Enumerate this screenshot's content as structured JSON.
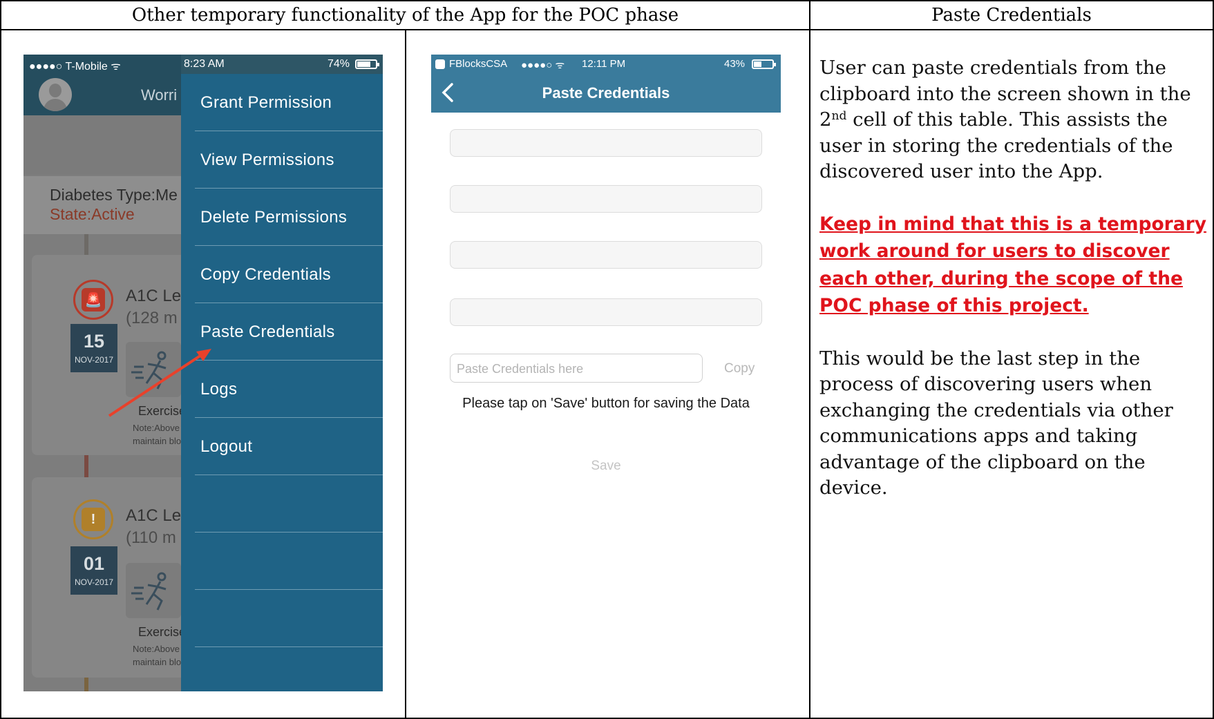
{
  "table": {
    "header_left": "Other temporary functionality of the App for the POC phase",
    "header_right": "Paste Credentials"
  },
  "phone_menu": {
    "status": {
      "carrier": "●●●●○ T-Mobile ᯤ",
      "time": "8:23 AM",
      "battery": "74%",
      "battery_level": 0.74
    },
    "header_title": "Worri",
    "info": {
      "diabetes_type": "Diabetes Type:Me",
      "state": "State:Active"
    },
    "cards": [
      {
        "title": "A1C Le",
        "value": "(128 m",
        "day": "15",
        "month": "NOV-2017",
        "exercise": "Exercise",
        "note_line1": "Note:Above",
        "note_line2": "maintain blo",
        "alert_color": "#b73a2a",
        "alert_symbol": "🚨"
      },
      {
        "title": "A1C Le",
        "value": "(110 m",
        "day": "01",
        "month": "NOV-2017",
        "exercise": "Exercise",
        "note_line1": "Note:Above",
        "note_line2": "maintain blo",
        "alert_color": "#b0802a",
        "alert_symbol": "!"
      }
    ],
    "menu_items": [
      "Grant Permission",
      "View Permissions",
      "Delete Permissions",
      "Copy Credentials",
      "Paste Credentials",
      "Logs",
      "Logout"
    ],
    "arrow_color": "#e8412b"
  },
  "phone_paste": {
    "status": {
      "back_app": "FBlocksCSA",
      "signal": "●●●●○ ᯤ",
      "time": "12:11 PM",
      "battery": "43%",
      "battery_level": 0.43
    },
    "nav_title": "Paste Credentials",
    "paste_placeholder": "Paste Credentials here",
    "copy_label": "Copy",
    "message": "Please tap on 'Save' button for saving the Data",
    "save_label": "Save",
    "accent_color": "#3a7b9c"
  },
  "description": {
    "p1_before_sup": "User can paste credentials from the clipboard into the screen shown in the 2",
    "p1_sup": "nd",
    "p1_after_sup": " cell of this table.  This assists the user in storing the credentials of the discovered user into the App.",
    "warning": "Keep in mind that this is a temporary work around for users to discover each other, during the scope of the POC phase of this project.",
    "p3": "This would be the last step in the process of discovering users when exchanging the credentials via other communications apps and taking advantage of the clipboard on the device.",
    "warning_color": "#e0141c"
  }
}
